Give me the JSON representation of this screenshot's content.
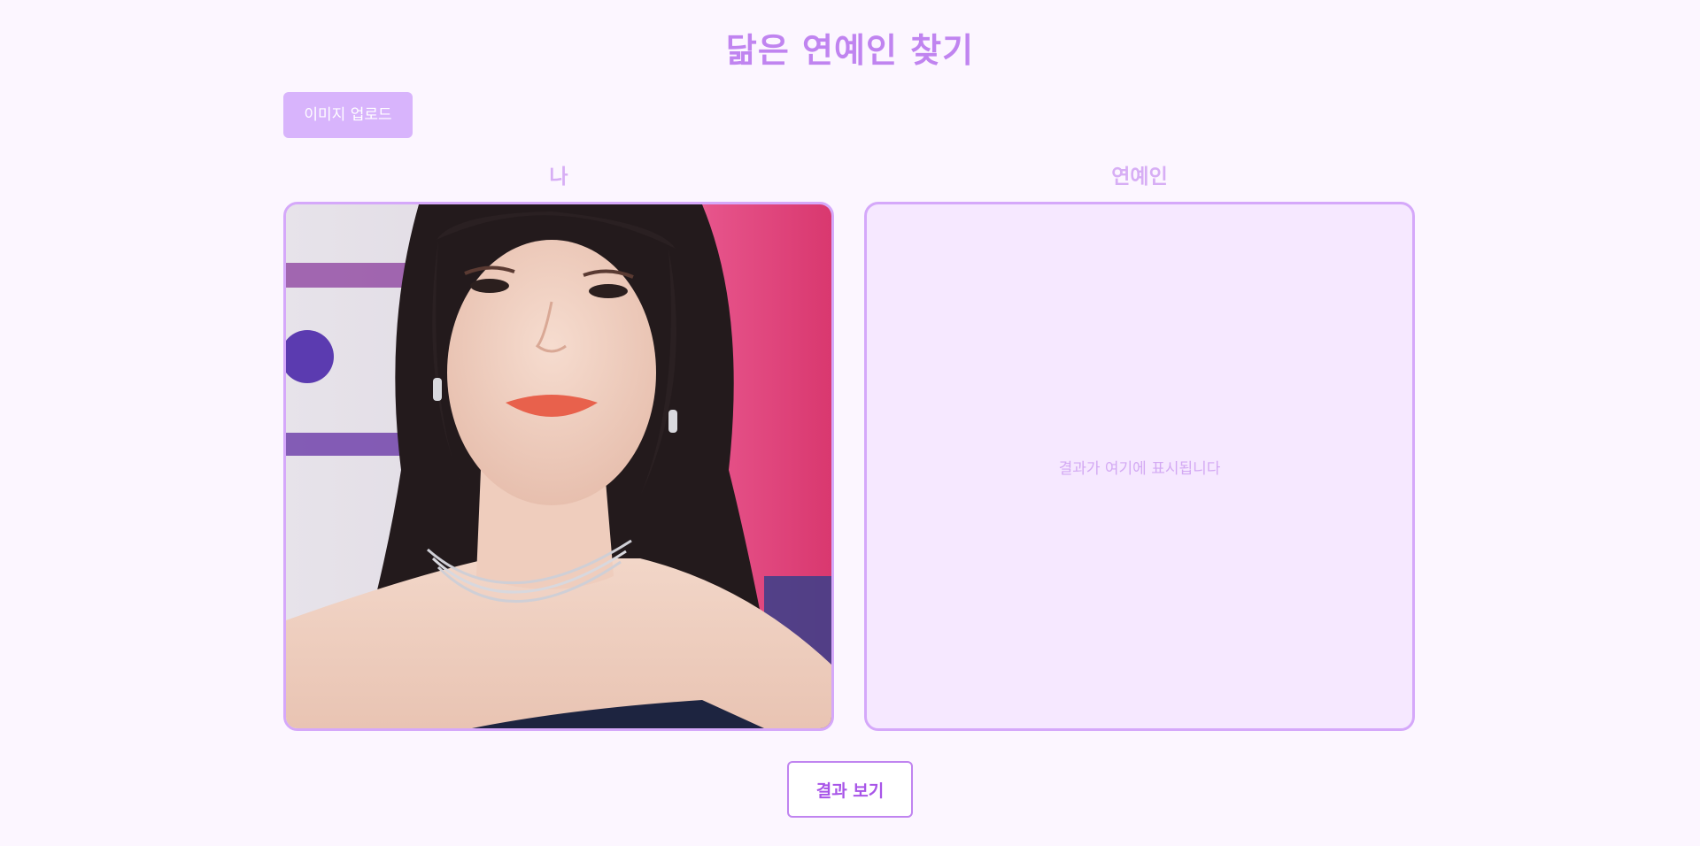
{
  "header": {
    "title": "닮은 연예인 찾기"
  },
  "controls": {
    "upload_label": "이미지 업로드",
    "result_label": "결과 보기"
  },
  "columns": {
    "me_label": "나",
    "celebrity_label": "연예인"
  },
  "result_panel": {
    "placeholder": "결과가 여기에 표시됩니다"
  },
  "colors": {
    "page_background": "#fcf6ff",
    "accent": "#c084f0",
    "upload_button": "#d8b4fc",
    "panel_border": "#d5a8fa",
    "result_background": "#f6e8ff"
  }
}
